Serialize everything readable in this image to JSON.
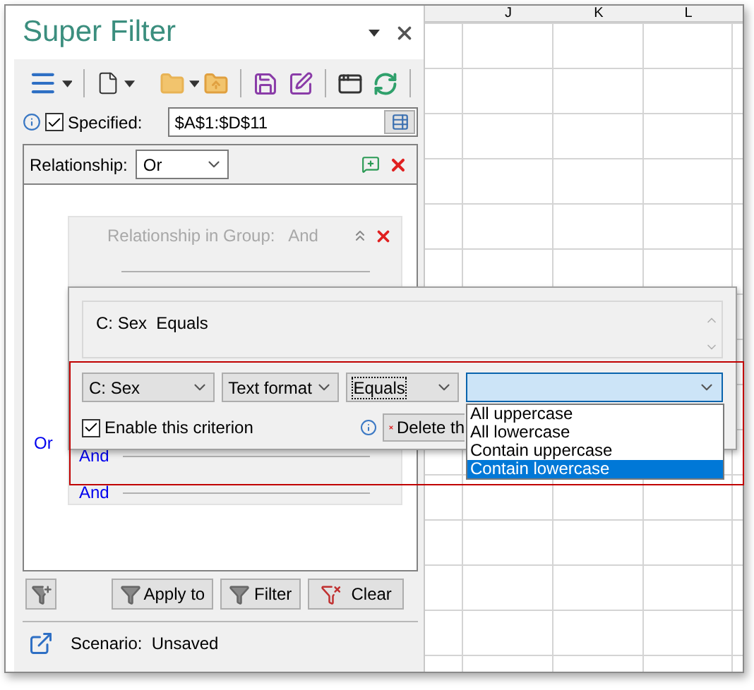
{
  "panel": {
    "title": "Super Filter"
  },
  "range": {
    "checked": true,
    "label": "Specified:",
    "value": "$A$1:$D$11"
  },
  "relationship": {
    "label": "Relationship:",
    "value": "Or"
  },
  "group": {
    "label": "Relationship in Group:",
    "value": "And"
  },
  "outer_connector": "Or",
  "group_rows": [
    "And",
    "And"
  ],
  "editor": {
    "summary": "C: Sex  Equals",
    "column": "C: Sex",
    "type": "Text format",
    "operator": "Equals",
    "enabled": {
      "checked": true,
      "label": "Enable this criterion"
    },
    "delete_button": "Delete th",
    "value_options": [
      {
        "label": "All uppercase",
        "selected": false
      },
      {
        "label": "All lowercase",
        "selected": false
      },
      {
        "label": "Contain uppercase",
        "selected": false
      },
      {
        "label": "Contain lowercase",
        "selected": true
      }
    ]
  },
  "buttons": [
    "Apply to",
    "Filter",
    "Clear"
  ],
  "scenario": {
    "label": "Scenario:",
    "value": "Unsaved"
  },
  "sheet": {
    "columns": [
      "J",
      "K",
      "L"
    ]
  }
}
